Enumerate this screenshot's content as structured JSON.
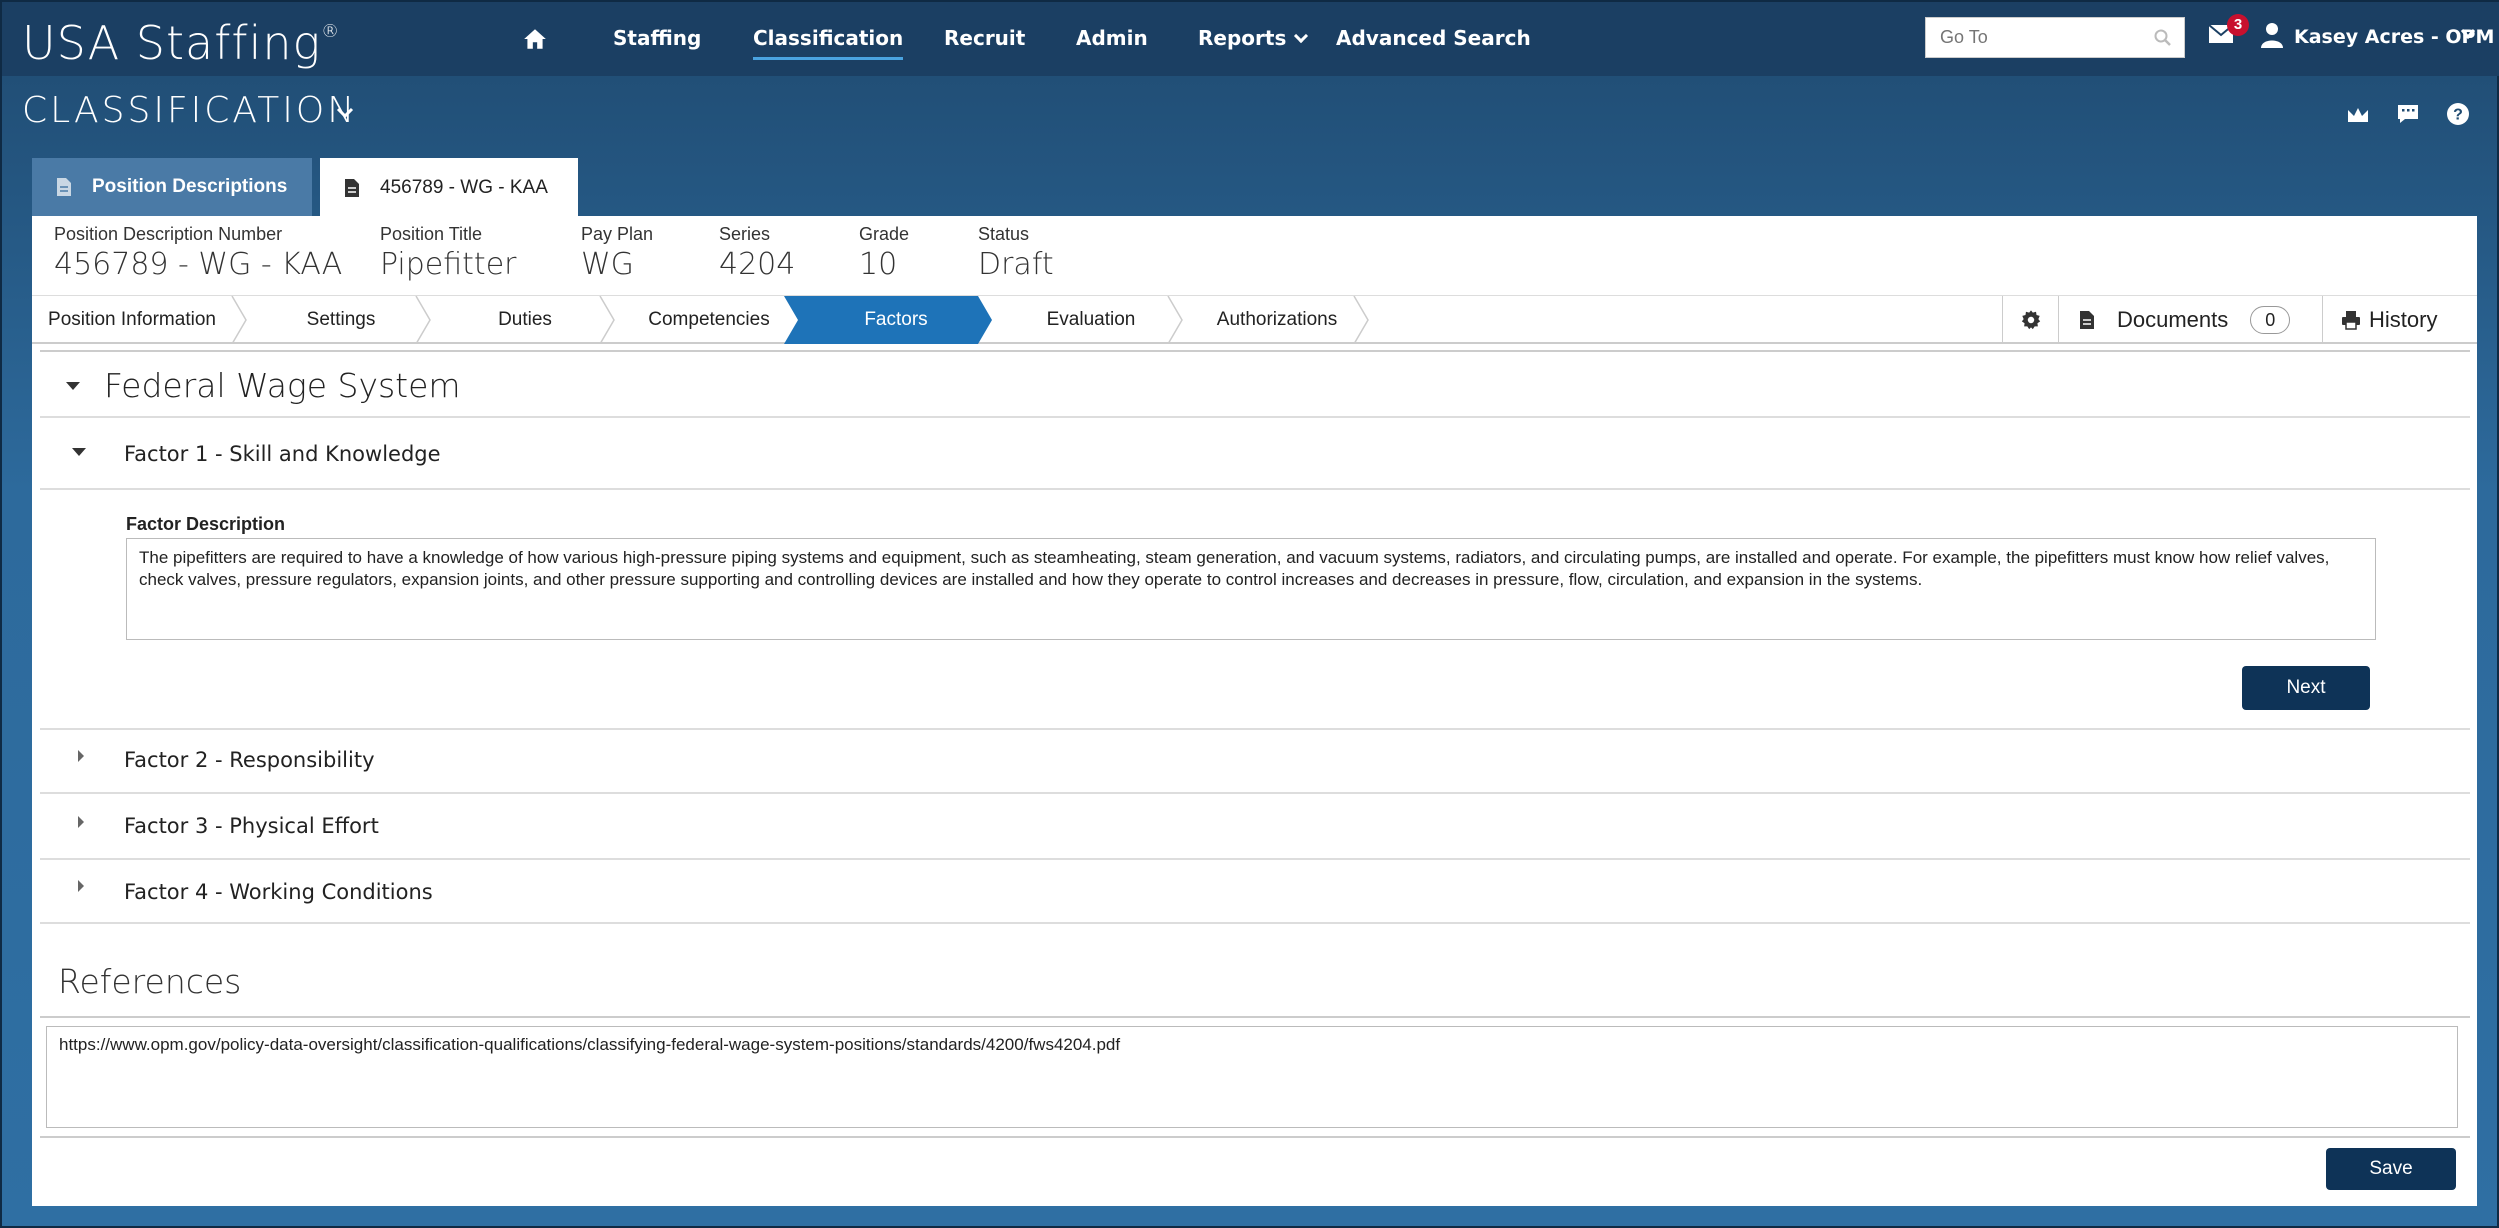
{
  "app": {
    "logo": "USA Staffing",
    "logo_mark": "®"
  },
  "nav": {
    "items": [
      "Staffing",
      "Classification",
      "Recruit",
      "Admin",
      "Reports",
      "Advanced Search"
    ],
    "goto_placeholder": "Go To",
    "mail_count": "3",
    "user": "Kasey Acres - OPM"
  },
  "section": {
    "title": "CLASSIFICATION"
  },
  "tabs": [
    "Position Descriptions",
    "456789 - WG - KAA"
  ],
  "summary": [
    {
      "label": "Position Description Number",
      "value": "456789 - WG - KAA"
    },
    {
      "label": "Position Title",
      "value": "Pipefitter"
    },
    {
      "label": "Pay Plan",
      "value": "WG"
    },
    {
      "label": "Series",
      "value": "4204"
    },
    {
      "label": "Grade",
      "value": "10"
    },
    {
      "label": "Status",
      "value": "Draft"
    }
  ],
  "steps": [
    "Position Information",
    "Settings",
    "Duties",
    "Competencies",
    "Factors",
    "Evaluation",
    "Authorizations"
  ],
  "tools": {
    "documents_label": "Documents",
    "documents_count": "0",
    "history_label": "History"
  },
  "fws": {
    "title": "Federal Wage System",
    "factors": [
      "Factor 1 - Skill and Knowledge",
      "Factor 2 - Responsibility",
      "Factor 3 - Physical Effort",
      "Factor 4 - Working Conditions"
    ],
    "factor_desc_label": "Factor Description",
    "factor_desc_text": "The pipefitters are required to have a knowledge of how various high-pressure piping systems and equipment, such as steamheating, steam generation, and vacuum systems, radiators, and circulating pumps, are installed and operate. For example, the pipefitters must know how relief valves, check valves, pressure regulators, expansion joints, and other pressure supporting and controlling devices are installed and how they operate to control increases and decreases in pressure, flow, circulation, and expansion in the systems.",
    "next_label": "Next"
  },
  "references": {
    "title": "References",
    "text": "https://www.opm.gov/policy-data-oversight/classification-qualifications/classifying-federal-wage-system-positions/standards/4200/fws4204.pdf",
    "save_label": "Save"
  },
  "colors": {
    "nav_bg": "#1b3f63",
    "active_step": "#1e73b8",
    "button": "#0e3357",
    "badge": "#c8102e"
  }
}
